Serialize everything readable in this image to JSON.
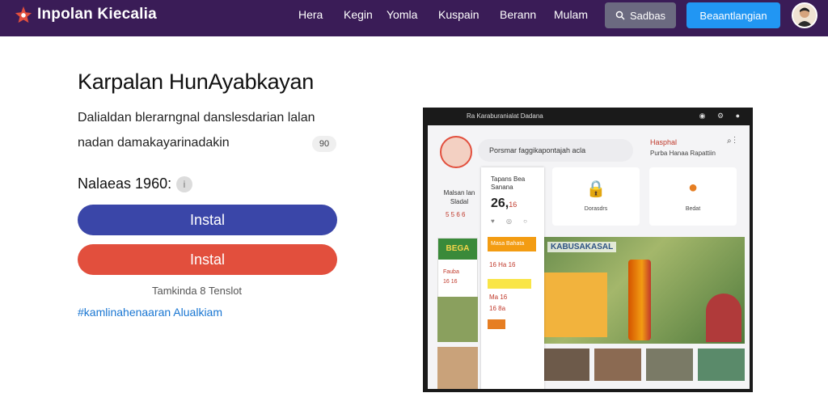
{
  "header": {
    "brand": "Inpolan Kiecalia",
    "nav": [
      "Hera",
      "Kegin",
      "Yomla",
      "Kuspain",
      "Berann",
      "Mulam"
    ],
    "search_label": "Sadbas",
    "cta_label": "Beaantlangian"
  },
  "main": {
    "title": "Karpalan HunAyabkayan",
    "description_line1": "Dalialdan blerarngnal danslesdarian lalan",
    "description_line2": "nadan damakayarinadakin",
    "description_badge": "90",
    "version": "Nalaeas 1960:",
    "install_primary": "Instal",
    "install_secondary": "Instal",
    "note": "Tamkinda 8 Tenslot",
    "hashtag": "#kamlinahenaaran Alualkiam"
  },
  "mockup": {
    "topbar_title": "Ra Karaburanialat Dadana",
    "search_text": "Porsmar faggikapontajah acla",
    "right_title": "Hasphal",
    "right_sub": "Purba Hanaa Rapattiin",
    "left_label": "Malsan lan Sladal",
    "left_rating": "5 5 6 6",
    "popup_title": "Tapans Bea Sanana",
    "popup_number": "26,",
    "popup_number_suffix": "16",
    "popup_orange": "Masa Bahata",
    "popup_row1": "16 Ha 16",
    "popup_row2": "Ma 16",
    "popup_row3": "16 8a",
    "card1_label": "Dorasdrs",
    "card2_label": "Bedat",
    "green_head": "BEGA",
    "green_line1": "Fauba",
    "green_line2": "16 16",
    "banner_text": "KABUSAKASAL"
  },
  "icons": {
    "brand": "star-logo-icon",
    "search": "search-icon",
    "avatar": "user-avatar-icon",
    "info": "info-icon"
  },
  "colors": {
    "topbar": "#3a1c57",
    "primary_button": "#3a46a8",
    "secondary_button": "#e24f3d",
    "cta": "#2196f3",
    "link": "#1976d2"
  }
}
